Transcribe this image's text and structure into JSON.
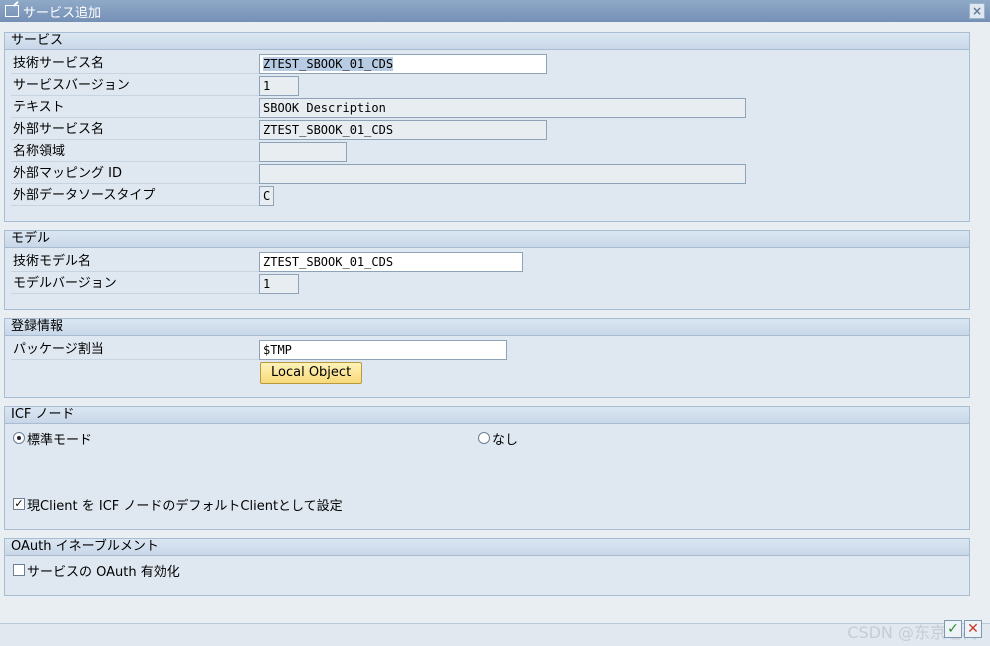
{
  "window": {
    "title": "サービス追加",
    "close_symbol": "×"
  },
  "service_group": {
    "header": "サービス",
    "tech_service_name": {
      "label": "技術サービス名",
      "value": "ZTEST_SBOOK_01_CDS"
    },
    "service_version": {
      "label": "サービスバージョン",
      "value": "1"
    },
    "text": {
      "label": "テキスト",
      "value": "SBOOK Description"
    },
    "external_service_name": {
      "label": "外部サービス名",
      "value": "ZTEST_SBOOK_01_CDS"
    },
    "namespace": {
      "label": "名称領域",
      "value": ""
    },
    "external_mapping_id": {
      "label": "外部マッピング ID",
      "value": ""
    },
    "external_datasource_type": {
      "label": "外部データソースタイプ",
      "value": "C"
    }
  },
  "model_group": {
    "header": "モデル",
    "tech_model_name": {
      "label": "技術モデル名",
      "value": "ZTEST_SBOOK_01_CDS"
    },
    "model_version": {
      "label": "モデルバージョン",
      "value": "1"
    }
  },
  "registration_group": {
    "header": "登録情報",
    "package": {
      "label": "パッケージ割当",
      "value": "$TMP"
    },
    "local_object_button": "Local Object"
  },
  "icf_group": {
    "header": "ICF ノード",
    "radio_standard": "標準モード",
    "radio_none": "なし",
    "checkbox_label": "現Client を ICF ノードのデフォルトClientとして設定",
    "checkbox_mark": "✓"
  },
  "oauth_group": {
    "header": "OAuth イネーブルメント",
    "checkbox_label": "サービスの OAuth 有効化"
  },
  "footer": {
    "watermark": "CSDN @东京老树",
    "ok_symbol": "✓",
    "cancel_symbol": "✕"
  }
}
